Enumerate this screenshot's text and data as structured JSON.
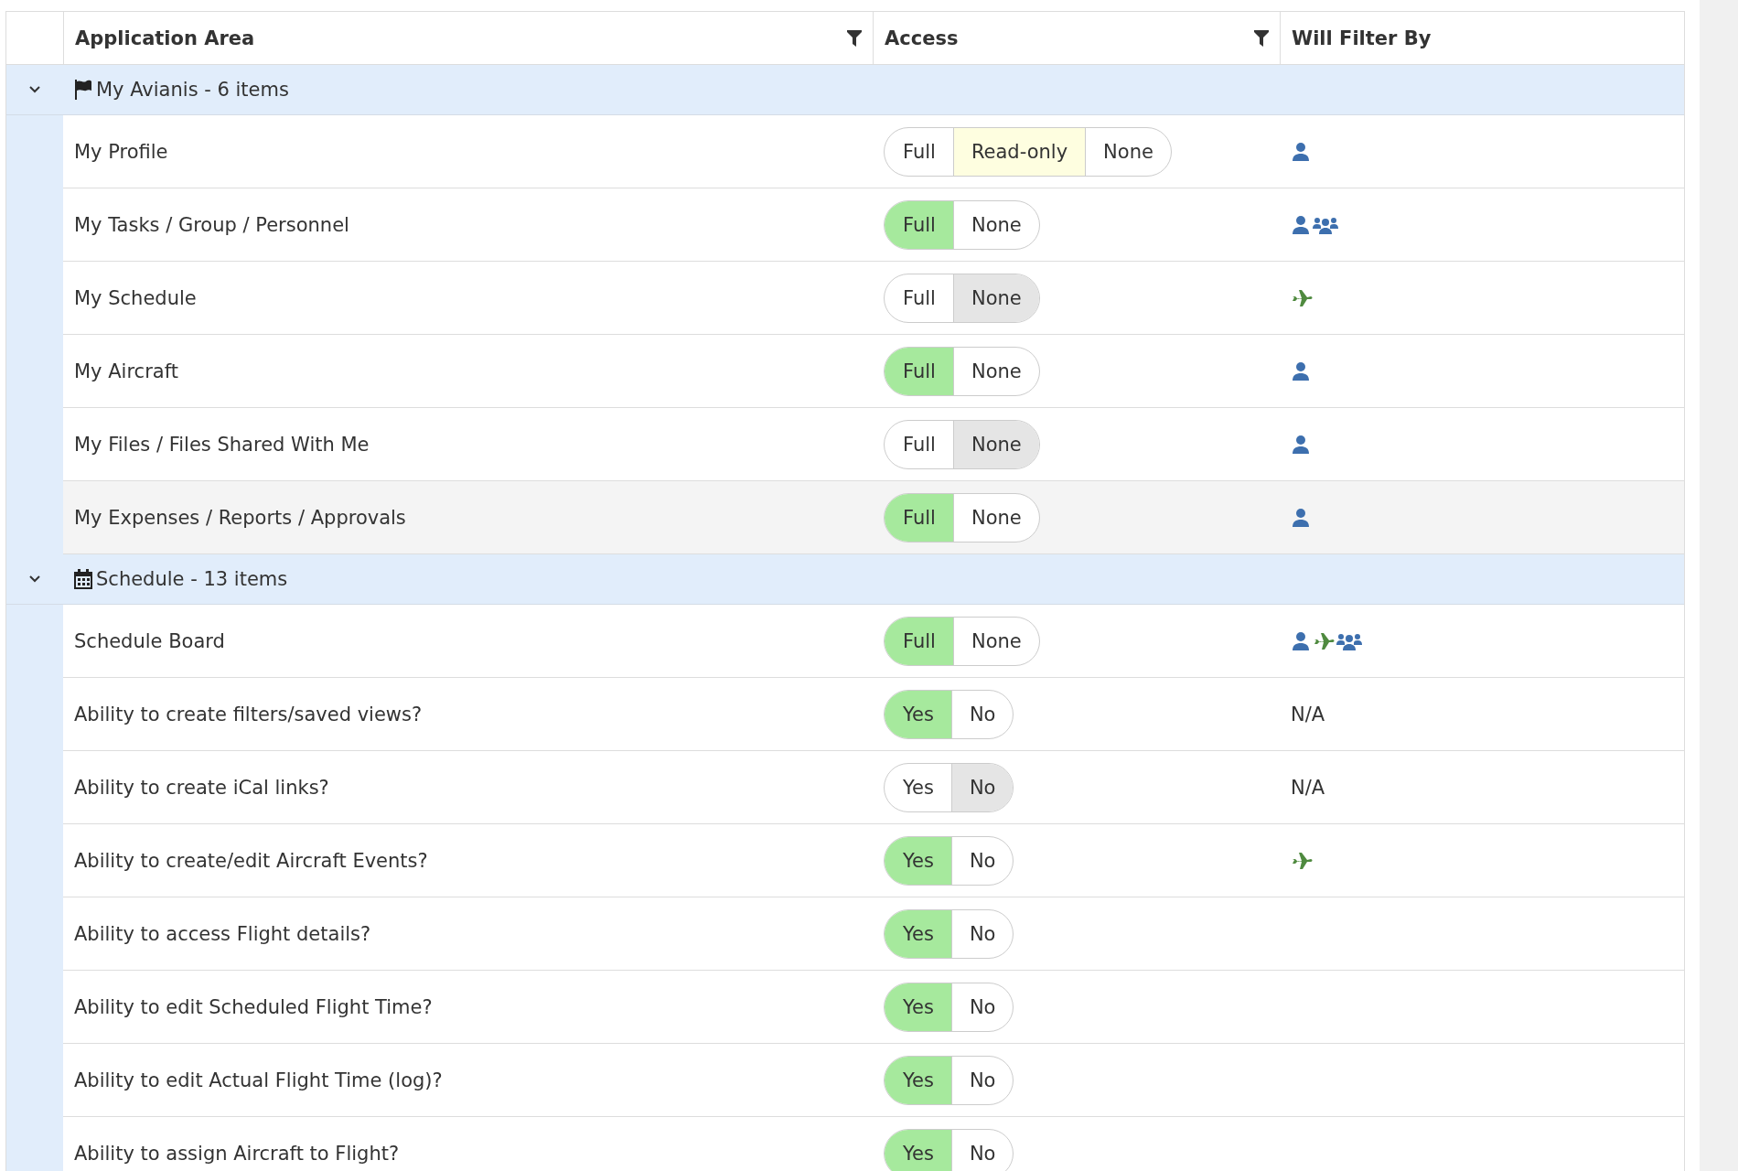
{
  "columns": [
    {
      "label": "Application Area",
      "filter": true
    },
    {
      "label": "Access",
      "filter": true
    },
    {
      "label": "Will Filter By",
      "filter": false
    }
  ],
  "groups": [
    {
      "title": "My Avianis - 6 items",
      "kind": "flag",
      "expanded": true,
      "rows": [
        {
          "name": "My Profile",
          "highlighted": false,
          "options": [
            {
              "label": "Full",
              "kind": "grant",
              "selected": false
            },
            {
              "label": "Read-only",
              "kind": "partial",
              "selected": true
            },
            {
              "label": "None",
              "kind": "deny",
              "selected": false
            }
          ],
          "filter": [
            {
              "kind": "person"
            }
          ]
        },
        {
          "name": "My Tasks / Group / Personnel",
          "highlighted": false,
          "options": [
            {
              "label": "Full",
              "kind": "grant",
              "selected": true
            },
            {
              "label": "None",
              "kind": "deny",
              "selected": false
            }
          ],
          "filter": [
            {
              "kind": "person"
            },
            {
              "kind": "group"
            }
          ]
        },
        {
          "name": "My Schedule",
          "highlighted": false,
          "options": [
            {
              "label": "Full",
              "kind": "grant",
              "selected": false
            },
            {
              "label": "None",
              "kind": "deny",
              "selected": true
            }
          ],
          "filter": [
            {
              "kind": "aircraft"
            }
          ]
        },
        {
          "name": "My Aircraft",
          "highlighted": false,
          "options": [
            {
              "label": "Full",
              "kind": "grant",
              "selected": true
            },
            {
              "label": "None",
              "kind": "deny",
              "selected": false
            }
          ],
          "filter": [
            {
              "kind": "person"
            }
          ]
        },
        {
          "name": "My Files / Files Shared With Me",
          "highlighted": false,
          "options": [
            {
              "label": "Full",
              "kind": "grant",
              "selected": false
            },
            {
              "label": "None",
              "kind": "deny",
              "selected": true
            }
          ],
          "filter": [
            {
              "kind": "person"
            }
          ]
        },
        {
          "name": "My Expenses / Reports / Approvals",
          "highlighted": true,
          "options": [
            {
              "label": "Full",
              "kind": "grant",
              "selected": true
            },
            {
              "label": "None",
              "kind": "deny",
              "selected": false
            }
          ],
          "filter": [
            {
              "kind": "person"
            }
          ]
        }
      ]
    },
    {
      "title": "Schedule - 13 items",
      "kind": "calendar",
      "expanded": true,
      "rows": [
        {
          "name": "Schedule Board",
          "highlighted": false,
          "options": [
            {
              "label": "Full",
              "kind": "grant",
              "selected": true
            },
            {
              "label": "None",
              "kind": "deny",
              "selected": false
            }
          ],
          "filter": [
            {
              "kind": "person"
            },
            {
              "kind": "aircraft"
            },
            {
              "kind": "group"
            }
          ]
        },
        {
          "name": "Ability to create filters/saved views?",
          "highlighted": false,
          "options": [
            {
              "label": "Yes",
              "kind": "grant",
              "selected": true
            },
            {
              "label": "No",
              "kind": "deny",
              "selected": false
            }
          ],
          "filter_text": "N/A"
        },
        {
          "name": "Ability to create iCal links?",
          "highlighted": false,
          "options": [
            {
              "label": "Yes",
              "kind": "grant",
              "selected": false
            },
            {
              "label": "No",
              "kind": "deny",
              "selected": true
            }
          ],
          "filter_text": "N/A"
        },
        {
          "name": "Ability to create/edit Aircraft Events?",
          "highlighted": false,
          "options": [
            {
              "label": "Yes",
              "kind": "grant",
              "selected": true
            },
            {
              "label": "No",
              "kind": "deny",
              "selected": false
            }
          ],
          "filter": [
            {
              "kind": "aircraft"
            }
          ]
        },
        {
          "name": "Ability to access Flight details?",
          "highlighted": false,
          "options": [
            {
              "label": "Yes",
              "kind": "grant",
              "selected": true
            },
            {
              "label": "No",
              "kind": "deny",
              "selected": false
            }
          ]
        },
        {
          "name": "Ability to edit Scheduled Flight Time?",
          "highlighted": false,
          "options": [
            {
              "label": "Yes",
              "kind": "grant",
              "selected": true
            },
            {
              "label": "No",
              "kind": "deny",
              "selected": false
            }
          ]
        },
        {
          "name": "Ability to edit Actual Flight Time (log)?",
          "highlighted": false,
          "options": [
            {
              "label": "Yes",
              "kind": "grant",
              "selected": true
            },
            {
              "label": "No",
              "kind": "deny",
              "selected": false
            }
          ]
        },
        {
          "name": "Ability to assign Aircraft to Flight?",
          "highlighted": false,
          "options": [
            {
              "label": "Yes",
              "kind": "grant",
              "selected": true
            },
            {
              "label": "No",
              "kind": "deny",
              "selected": false
            }
          ]
        }
      ]
    }
  ]
}
